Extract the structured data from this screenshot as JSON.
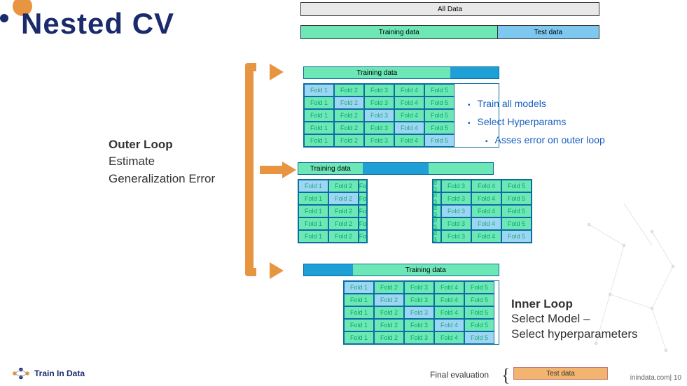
{
  "title": "Nested CV",
  "outerLoop": {
    "heading": "Outer Loop",
    "sub1": "Estimate",
    "sub2": "Generalization Error"
  },
  "innerLoop": {
    "heading": "Inner Loop",
    "sub1": "Select Model –",
    "sub2": "Select hyperparameters"
  },
  "bars": {
    "allData": "All Data",
    "trainingData": "Training data",
    "testData": "Test data"
  },
  "folds": [
    "Fold 1",
    "Fold 2",
    "Fold 3",
    "Fold 4",
    "Fold 5"
  ],
  "bullets": {
    "b1": "Train all models",
    "b2": "Select Hyperparams",
    "b3": "Asses error on outer loop"
  },
  "finalEval": {
    "label": "Final evaluation",
    "box": "Test data"
  },
  "logo": "Train In Data",
  "footer": "inindata.com| 10"
}
